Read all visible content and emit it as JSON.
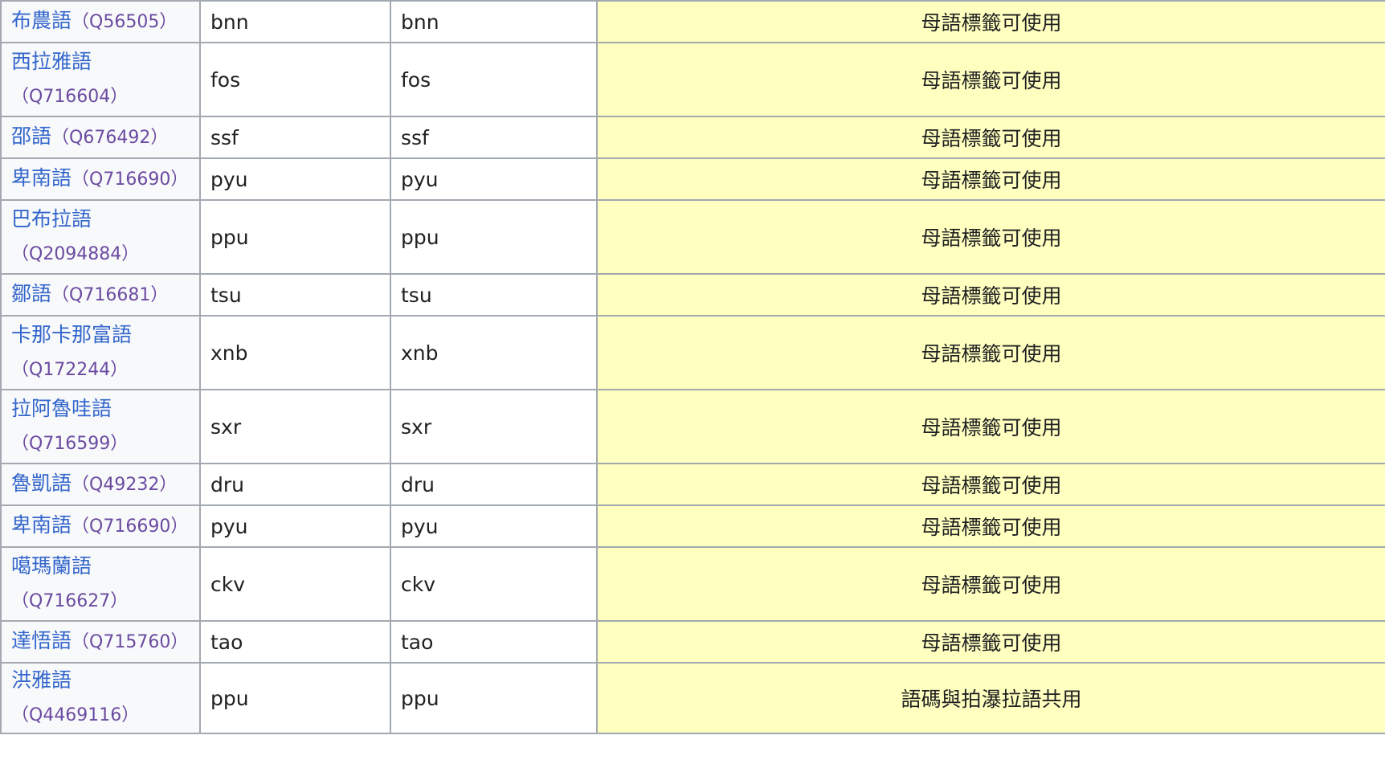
{
  "rows": [
    {
      "name": "布農語",
      "qid": "（Q56505）",
      "code1": "bnn",
      "code2": "bnn",
      "status": "母語標籤可使用",
      "two_line": false
    },
    {
      "name": "西拉雅語",
      "qid": "（Q716604）",
      "code1": "fos",
      "code2": "fos",
      "status": "母語標籤可使用",
      "two_line": true
    },
    {
      "name": "邵語",
      "qid": "（Q676492）",
      "code1": "ssf",
      "code2": "ssf",
      "status": "母語標籤可使用",
      "two_line": false
    },
    {
      "name": "卑南語",
      "qid": "（Q716690）",
      "code1": "pyu",
      "code2": "pyu",
      "status": "母語標籤可使用",
      "two_line": false
    },
    {
      "name": "巴布拉語",
      "qid": "（Q2094884）",
      "code1": "ppu",
      "code2": "ppu",
      "status": "母語標籤可使用",
      "two_line": true
    },
    {
      "name": "鄒語",
      "qid": "（Q716681）",
      "code1": "tsu",
      "code2": "tsu",
      "status": "母語標籤可使用",
      "two_line": false
    },
    {
      "name": "卡那卡那富語",
      "qid": "（Q172244）",
      "code1": "xnb",
      "code2": "xnb",
      "status": "母語標籤可使用",
      "two_line": true
    },
    {
      "name": "拉阿魯哇語",
      "qid": "（Q716599）",
      "code1": "sxr",
      "code2": "sxr",
      "status": "母語標籤可使用",
      "two_line": true
    },
    {
      "name": "魯凱語",
      "qid": "（Q49232）",
      "code1": "dru",
      "code2": "dru",
      "status": "母語標籤可使用",
      "two_line": false
    },
    {
      "name": "卑南語",
      "qid": "（Q716690）",
      "code1": "pyu",
      "code2": "pyu",
      "status": "母語標籤可使用",
      "two_line": false
    },
    {
      "name": "噶瑪蘭語",
      "qid": "（Q716627）",
      "code1": "ckv",
      "code2": "ckv",
      "status": "母語標籤可使用",
      "two_line": true
    },
    {
      "name": "達悟語",
      "qid": "（Q715760）",
      "code1": "tao",
      "code2": "tao",
      "status": "母語標籤可使用",
      "two_line": false
    },
    {
      "name": "洪雅語",
      "qid": "（Q4469116）",
      "code1": "ppu",
      "code2": "ppu",
      "status": "語碼與拍瀑拉語共用",
      "two_line": false
    }
  ]
}
